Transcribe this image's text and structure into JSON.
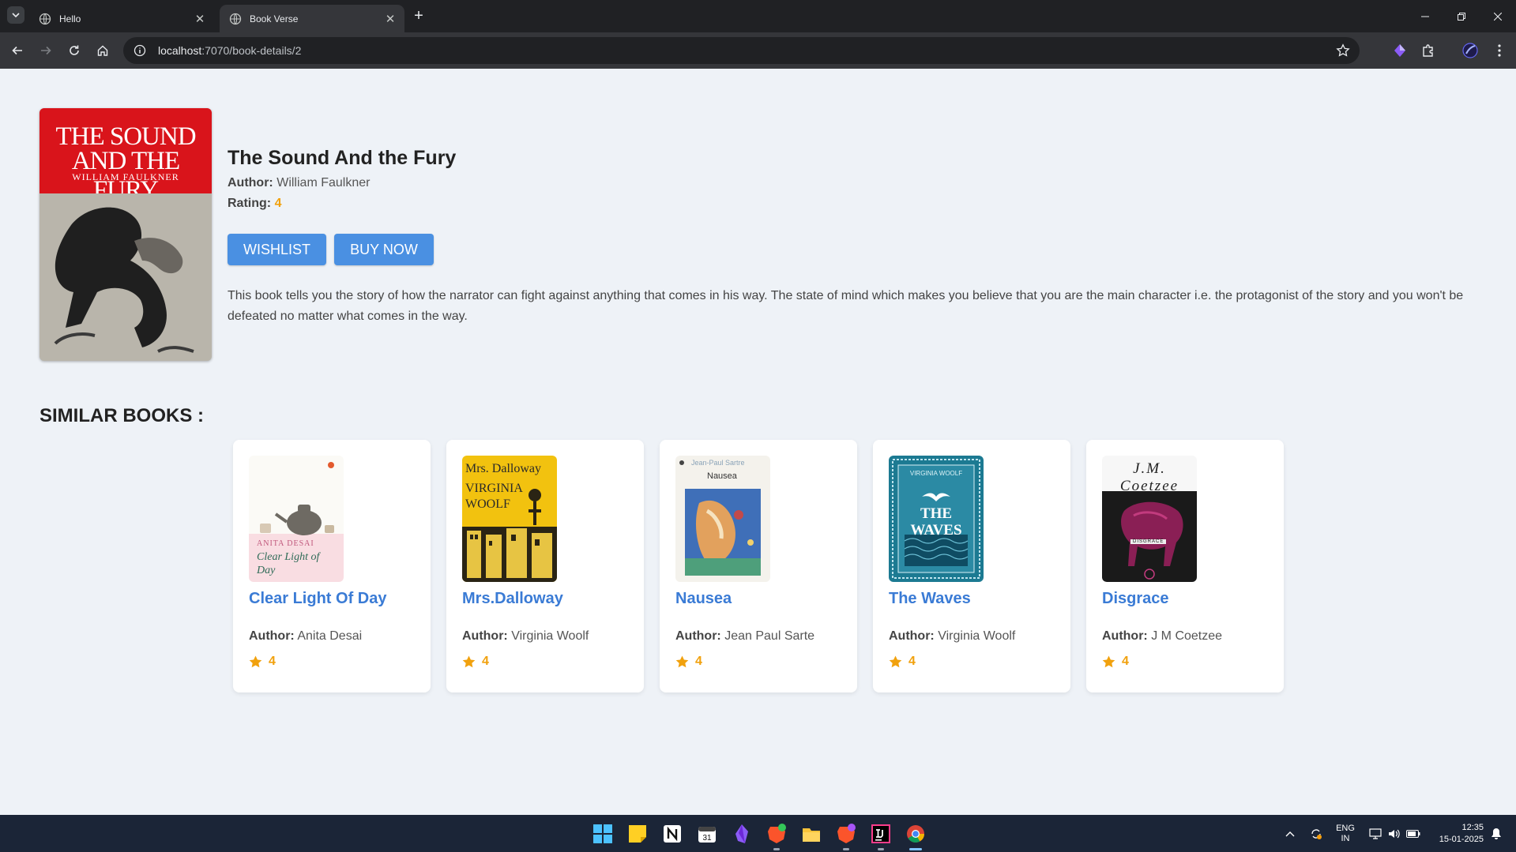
{
  "browser": {
    "tabs": [
      {
        "label": "Hello",
        "active": false
      },
      {
        "label": "Book Verse",
        "active": true
      }
    ],
    "url_host": "localhost",
    "url_rest": ":7070/book-details/2"
  },
  "book": {
    "cover_title_line1": "THE SOUND",
    "cover_title_line2": "AND THE FURY",
    "cover_author": "WILLIAM FAULKNER",
    "title": "The Sound And the Fury",
    "author_label": "Author:",
    "author": "William Faulkner",
    "rating_label": "Rating:",
    "rating": "4",
    "wishlist_label": "WISHLIST",
    "buy_label": "BUY NOW",
    "description": "This book tells you the story of how the narrator can fight against anything that comes in his way. The state of mind which makes you believe that you are the main character i.e. the protagonist of the story and you won't be defeated no matter what comes in the way."
  },
  "similar": {
    "heading": "SIMILAR BOOKS :",
    "books": [
      {
        "title": "Clear Light Of Day",
        "author_label": "Author:",
        "author": "Anita Desai",
        "rating": "4",
        "cover_top": "ANITA DESAI",
        "cover_title": "Clear Light of Day"
      },
      {
        "title": "Mrs.Dalloway",
        "author_label": "Author:",
        "author": "Virginia Woolf",
        "rating": "4",
        "cover_top": "Mrs. Dalloway",
        "cover_title": "VIRGINIA WOOLF"
      },
      {
        "title": "Nausea",
        "author_label": "Author:",
        "author": "Jean Paul Sarte",
        "rating": "4",
        "cover_top": "Jean-Paul Sartre",
        "cover_title": "Nausea"
      },
      {
        "title": "The Waves",
        "author_label": "Author:",
        "author": "Virginia Woolf",
        "rating": "4",
        "cover_top": "VIRGINIA WOOLF",
        "cover_title": "THE WAVES"
      },
      {
        "title": "Disgrace",
        "author_label": "Author:",
        "author": "J M Coetzee",
        "rating": "4",
        "cover_top": "J.M. Coetzee",
        "cover_title": "DISGRACE"
      }
    ]
  },
  "taskbar": {
    "lang_top": "ENG",
    "lang_bottom": "IN",
    "time": "12:35",
    "date": "15-01-2025"
  },
  "colors": {
    "accent": "#4a90e2",
    "link": "#3a7bd5",
    "rating": "#f1a10d",
    "page_bg": "#eef2f7"
  }
}
